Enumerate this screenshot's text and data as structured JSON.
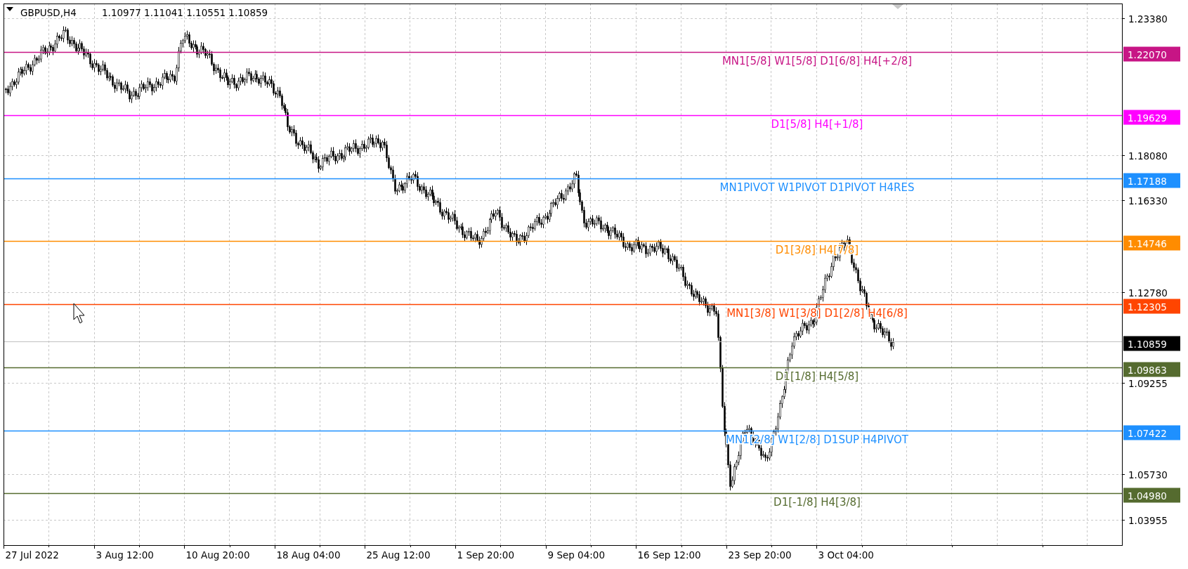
{
  "header": {
    "symbol": "GBPUSD,H4",
    "ohlc": "1.10977 1.11041 1.10551 1.10859"
  },
  "price_axis": {
    "ticks": [
      "1.23380",
      "1.18080",
      "1.16330",
      "1.12780",
      "1.09255",
      "1.05730",
      "1.03955"
    ]
  },
  "levels": [
    {
      "kind": "level",
      "label": "MN1[5/8] W1[5/8] D1[6/8] H4[+2/8]",
      "price": "1.22070",
      "color": "#c71585"
    },
    {
      "kind": "level",
      "label": "D1[5/8] H4[+1/8]",
      "price": "1.19629",
      "color": "#ff00ff"
    },
    {
      "kind": "level",
      "label": "MN1PIVOT W1PIVOT D1PIVOT H4RES",
      "price": "1.17188",
      "color": "#1e90ff"
    },
    {
      "kind": "level",
      "label": "D1[3/8] H4[7/8]",
      "price": "1.14746",
      "color": "#ff8c00"
    },
    {
      "kind": "level",
      "label": "MN1[3/8] W1[3/8] D1[2/8] H4[6/8]",
      "price": "1.12305",
      "color": "#ff4500"
    },
    {
      "kind": "current",
      "price": "1.10859",
      "color": "#000000"
    },
    {
      "kind": "level",
      "label": "D1[1/8] H4[5/8]",
      "price": "1.09863",
      "color": "#556b2f"
    },
    {
      "kind": "level",
      "label": "MN1[2/8] W1[2/8] D1SUP H4PIVOT",
      "price": "1.07422",
      "color": "#1e90ff"
    },
    {
      "kind": "level",
      "label": "D1[-1/8] H4[3/8]",
      "price": "1.04980",
      "color": "#556b2f"
    }
  ],
  "time_axis": {
    "ticks": [
      "27 Jul 2022",
      "3 Aug 12:00",
      "10 Aug 20:00",
      "18 Aug 04:00",
      "25 Aug 12:00",
      "1 Sep 20:00",
      "9 Sep 04:00",
      "16 Sep 12:00",
      "23 Sep 20:00",
      "3 Oct 04:00"
    ]
  }
}
